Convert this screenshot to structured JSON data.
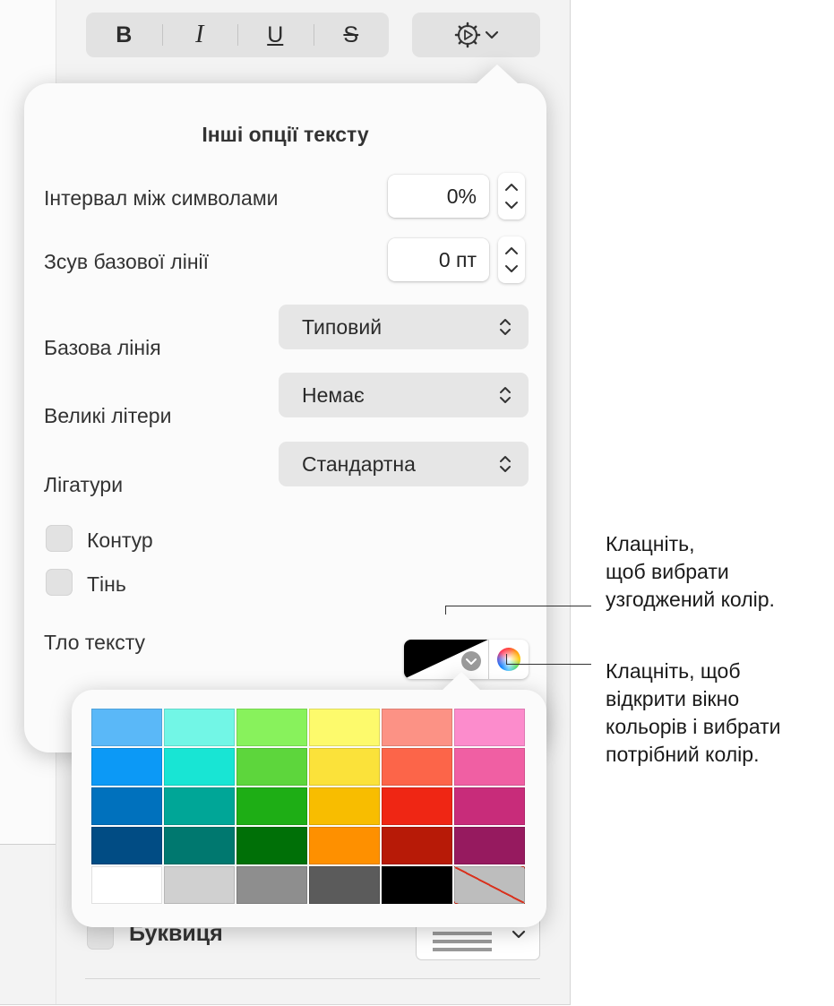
{
  "toolbar": {
    "bold_label": "B",
    "italic_label": "I",
    "underline_label": "U",
    "strikethrough_label": "S"
  },
  "popover": {
    "title": "Інші опції тексту",
    "character_spacing": {
      "label": "Інтервал між символами",
      "value": "0%"
    },
    "baseline_shift": {
      "label": "Зсув базової лінії",
      "value": "0 пт"
    },
    "baseline": {
      "label": "Базова лінія",
      "selected": "Типовий"
    },
    "capitalization": {
      "label": "Великі літери",
      "selected": "Немає"
    },
    "ligatures": {
      "label": "Лігатури",
      "selected": "Стандартна"
    },
    "outline": {
      "label": "Контур",
      "checked": false
    },
    "shadow": {
      "label": "Тінь",
      "checked": false
    },
    "text_background": {
      "label": "Тло тексту",
      "color": "#000000"
    }
  },
  "palette": {
    "colors": [
      [
        "#5ab8f8",
        "#72f6e6",
        "#88f25c",
        "#fdfa6c",
        "#fc9285",
        "#fc8ccc"
      ],
      [
        "#0c99f6",
        "#18e5d4",
        "#5dd63c",
        "#fbe23a",
        "#fc6549",
        "#f05fa3"
      ],
      [
        "#0071bd",
        "#00a697",
        "#1eae15",
        "#f8bd00",
        "#ef2614",
        "#c82c7a"
      ],
      [
        "#014c84",
        "#00786f",
        "#007007",
        "#fe9000",
        "#b71a07",
        "#961a5f"
      ],
      [
        "#ffffff",
        "#d0d0d0",
        "#8e8e8e",
        "#5b5b5b",
        "#000000",
        "none"
      ]
    ]
  },
  "dropcap": {
    "label": "Буквиця"
  },
  "callouts": {
    "matched_color": [
      "Клацніть,",
      "щоб вибрати",
      "узгоджений колір."
    ],
    "color_window": [
      "Клацніть, щоб",
      "відкрити вікно",
      "кольорів і вибрати",
      "потрібний колір."
    ]
  }
}
